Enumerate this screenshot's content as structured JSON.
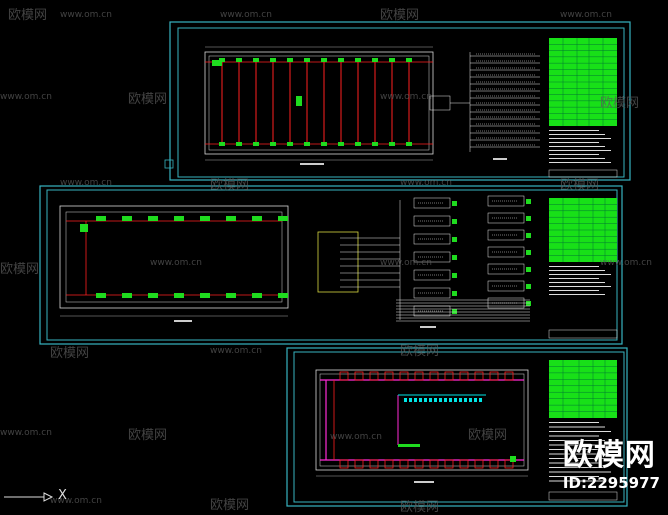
{
  "watermarks": {
    "site": "www.om.cn",
    "brand": "欧模网"
  },
  "brand_badge": {
    "logo": "欧模网",
    "id": "ID:2295977"
  },
  "ucs": {
    "axis_label": "X"
  },
  "colors": {
    "background": "#000000",
    "sheet_border": "#37b3c0",
    "line_cyan": "#00e5e5",
    "line_red": "#ff2020",
    "line_green": "#1fdc1f",
    "line_white": "#e8e8e8",
    "line_magenta": "#ff2bd6",
    "line_yellow": "#d8d840",
    "table_green": "#18e018"
  }
}
